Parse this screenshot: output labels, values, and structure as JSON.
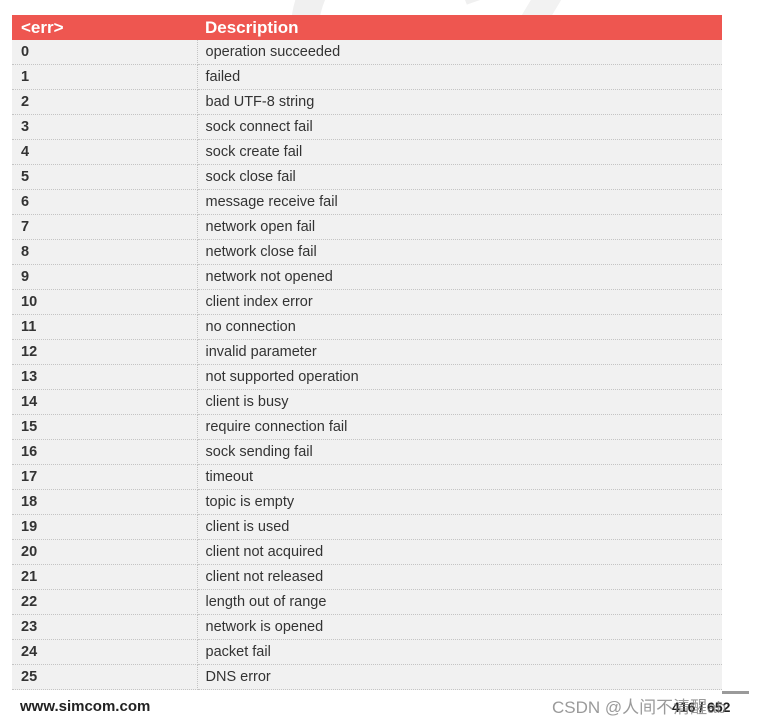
{
  "table": {
    "headers": {
      "code": "<err>",
      "description": "Description"
    },
    "rows": [
      {
        "code": "0",
        "description": "operation succeeded"
      },
      {
        "code": "1",
        "description": "failed"
      },
      {
        "code": "2",
        "description": "bad UTF-8 string"
      },
      {
        "code": "3",
        "description": "sock connect fail"
      },
      {
        "code": "4",
        "description": "sock create fail"
      },
      {
        "code": "5",
        "description": "sock close fail"
      },
      {
        "code": "6",
        "description": "message receive fail"
      },
      {
        "code": "7",
        "description": "network open fail"
      },
      {
        "code": "8",
        "description": "network close fail"
      },
      {
        "code": "9",
        "description": "network not opened"
      },
      {
        "code": "10",
        "description": "client index error"
      },
      {
        "code": "11",
        "description": "no connection"
      },
      {
        "code": "12",
        "description": "invalid parameter"
      },
      {
        "code": "13",
        "description": "not supported operation"
      },
      {
        "code": "14",
        "description": "client is busy"
      },
      {
        "code": "15",
        "description": "require connection fail"
      },
      {
        "code": "16",
        "description": "sock sending fail"
      },
      {
        "code": "17",
        "description": "timeout"
      },
      {
        "code": "18",
        "description": "topic is empty"
      },
      {
        "code": "19",
        "description": "client is used"
      },
      {
        "code": "20",
        "description": "client not acquired"
      },
      {
        "code": "21",
        "description": "client not released"
      },
      {
        "code": "22",
        "description": "length out of range"
      },
      {
        "code": "23",
        "description": "network is opened"
      },
      {
        "code": "24",
        "description": "packet fail"
      },
      {
        "code": "25",
        "description": "DNS error"
      }
    ]
  },
  "footer": {
    "url": "www.simcom.com",
    "page": "416 / 652",
    "watermark": "CSDN @人间不清醒ab"
  },
  "colors": {
    "header_bg": "#ee5650",
    "row_bg": "#f1f1f1"
  }
}
